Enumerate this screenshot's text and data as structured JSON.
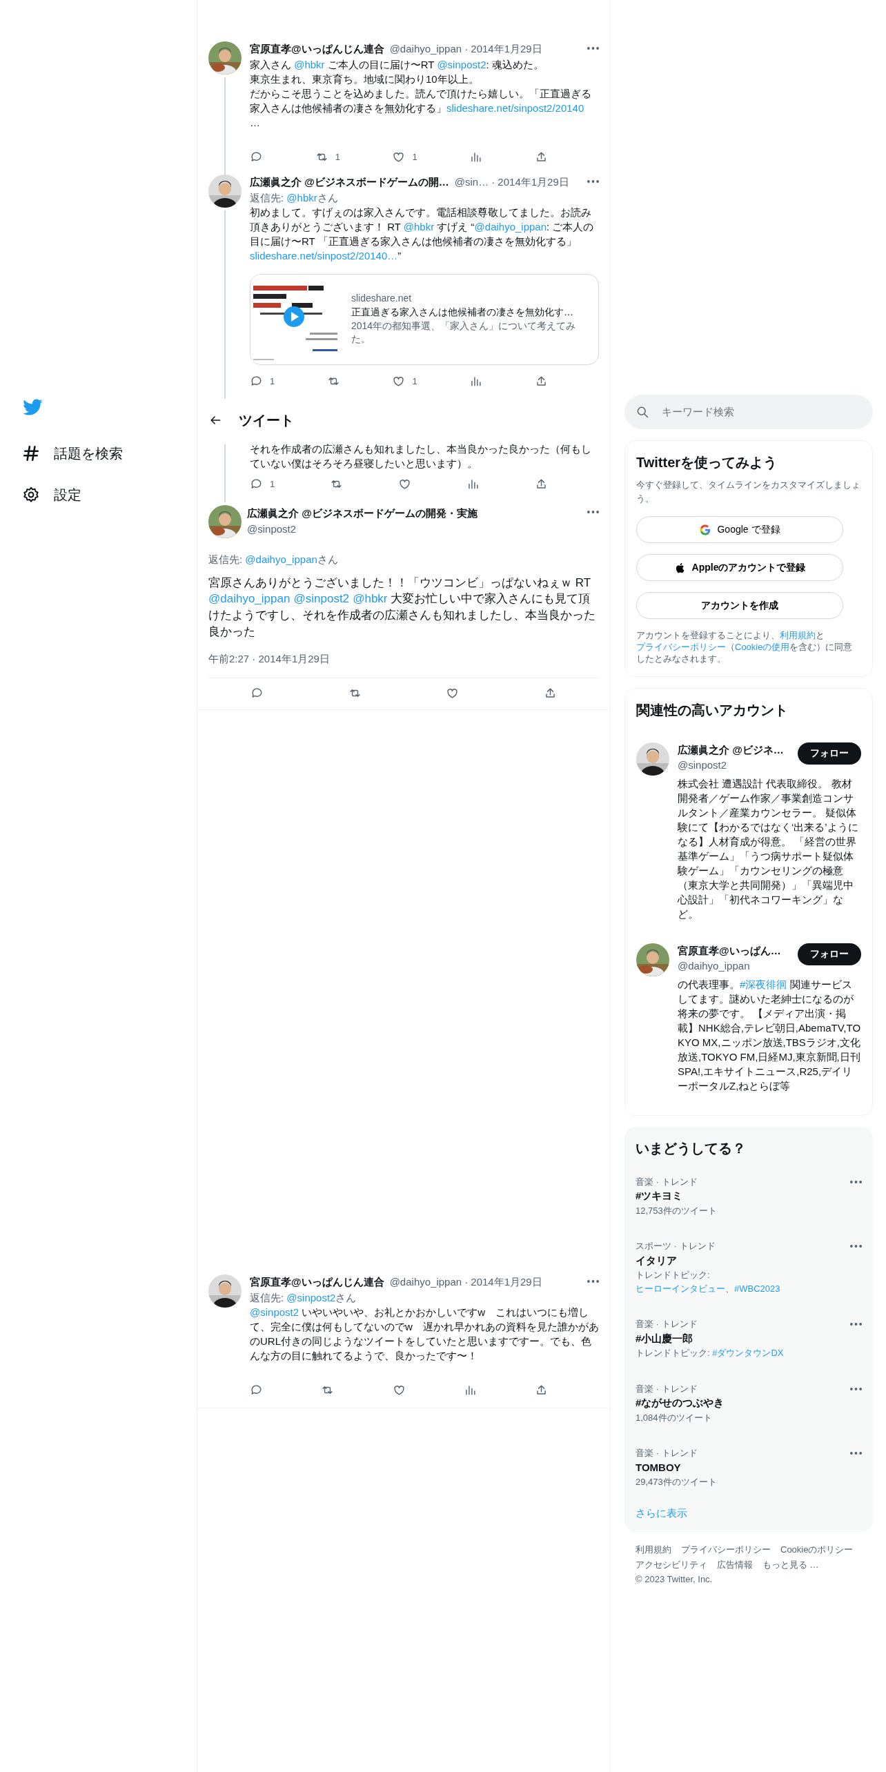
{
  "nav": {
    "items": [
      {
        "kind": "hash",
        "label": "話題を検索"
      },
      {
        "kind": "gear",
        "label": "設定"
      }
    ]
  },
  "timeline": [
    {
      "kind": "tweet",
      "name": "宮原直孝@いっぱんじん連合",
      "handle": "@daihyo_ippan",
      "date": "· 2014年1月29日",
      "connector": true,
      "body": [
        {
          "text": "家入さん "
        },
        {
          "link": "@hbkr"
        },
        {
          "text": " ご本人の目に届け〜RT "
        },
        {
          "link": "@sinpost2"
        },
        {
          "text": ": 魂込めた。"
        },
        {
          "text": "東京生まれ、東京育ち。地域に関わり10年以上。",
          "break_before": true
        },
        {
          "text": "だからこそ思うことを込めました。読んで頂けたら嬉しい。「正直過ぎる家入さんは他候補者の凄さを無効化する」",
          "break_before": true
        },
        {
          "link": "slideshare.net/sinpost2/20140"
        },
        {
          "text": "…",
          "break_before": true
        }
      ],
      "actions": [
        {
          "kind": "reply"
        },
        {
          "kind": "retweet",
          "count": "1"
        },
        {
          "kind": "like",
          "count": "1"
        },
        {
          "kind": "views"
        },
        {
          "kind": "share"
        }
      ]
    },
    {
      "kind": "tweet",
      "name": "広瀬眞之介 @ビジネスボードゲームの開…",
      "handle": "@sin…",
      "date": "· 2014年1月29日",
      "connector": true,
      "reply_to": [
        {
          "text": "返信先: "
        },
        {
          "link": "@hbkr"
        },
        {
          "text": "さん"
        }
      ],
      "body": [
        {
          "text": "初めまして。すげぇのは家入さんです。電話相談尊敬してました。お読み頂きありがとうございます！ RT "
        },
        {
          "link": "@hbkr"
        },
        {
          "text": " すげえ “"
        },
        {
          "link": "@daihyo_ippan"
        },
        {
          "text": ": ご本人の目に届け〜RT 「正直過ぎる家入さんは他候補者の凄さを無効化する」"
        },
        {
          "link": "slideshare.net/sinpost2/20140…"
        },
        {
          "text": "”"
        }
      ],
      "card": {
        "domain": "slideshare.net",
        "title": "正直過ぎる家入さんは他候補者の凄さを無効化す…",
        "description": "2014年の都知事選、「家入さん」について考えてみた。"
      },
      "actions": [
        {
          "kind": "reply",
          "count": "1"
        },
        {
          "kind": "retweet"
        },
        {
          "kind": "like",
          "count": "1"
        },
        {
          "kind": "views"
        },
        {
          "kind": "share"
        }
      ]
    },
    {
      "kind": "header",
      "title": "ツイート"
    },
    {
      "kind": "partial",
      "connector": true,
      "body": [
        {
          "text": "それを作成者の広瀬さんも知れましたし、本当良かった良かった（何もしていない僕はそろそろ昼寝したいと思います）。"
        }
      ],
      "actions": [
        {
          "kind": "reply",
          "count": "1"
        },
        {
          "kind": "retweet"
        },
        {
          "kind": "like"
        },
        {
          "kind": "views"
        },
        {
          "kind": "share"
        }
      ]
    },
    {
      "kind": "focus",
      "name": "広瀬眞之介 @ビジネスボードゲームの開発・実施",
      "handle": "@sinpost2",
      "reply_to": [
        {
          "text": "返信先: "
        },
        {
          "link": "@daihyo_ippan"
        },
        {
          "text": "さん"
        }
      ],
      "body": [
        {
          "text": "宮原さんありがとうございました！！「ウツコンビ」っぱないねぇｗ RT "
        },
        {
          "link": "@daihyo_ippan"
        },
        {
          "link": "@sinpost2"
        },
        {
          "link": "@hbkr"
        },
        {
          "text": " 大変お忙しい中で家入さんにも見て頂けたようですし、それを作成者の広瀬さんも知れましたし、本当良かった良かった"
        }
      ],
      "time": "午前2:27 · 2014年1月29日",
      "actions": [
        {
          "kind": "reply"
        },
        {
          "kind": "retweet"
        },
        {
          "kind": "like"
        },
        {
          "kind": "share"
        }
      ]
    },
    {
      "kind": "tweet",
      "name": "宮原直孝@いっぱんじん連合",
      "handle": "@daihyo_ippan",
      "date": "· 2014年1月29日",
      "connector": false,
      "reply_to": [
        {
          "text": "返信先: "
        },
        {
          "link": "@sinpost2"
        },
        {
          "text": "さん"
        }
      ],
      "body": [
        {
          "link": "@sinpost2"
        },
        {
          "text": " いやいやいや、お礼とかおかしいですw　これはいつにも増して、完全に僕は何もしてないのでw　遅かれ早かれあの資料を見た誰かがあのURL付きの同じようなツイートをしていたと思いますですー。でも、色んな方の目に触れてるようで、良かったです〜！"
        }
      ],
      "actions": [
        {
          "kind": "reply"
        },
        {
          "kind": "retweet"
        },
        {
          "kind": "like"
        },
        {
          "kind": "views"
        },
        {
          "kind": "share"
        }
      ]
    }
  ],
  "search": {
    "placeholder": "キーワード検索"
  },
  "signup": {
    "title": "Twitterを使ってみよう",
    "subtitle": "今すぐ登録して、タイムラインをカスタマイズしましょう。",
    "buttons": [
      {
        "kind": "google",
        "label": "Google で登録"
      },
      {
        "kind": "apple",
        "label": "Appleのアカウントで登録"
      },
      {
        "kind": "plain",
        "label": "アカウントを作成"
      }
    ],
    "legal": [
      {
        "text": "アカウントを登録することにより、"
      },
      {
        "link": "利用規約"
      },
      {
        "text": "と"
      },
      {
        "link": "プライバシーポリシー"
      },
      {
        "text": "（"
      },
      {
        "link": "Cookieの使用"
      },
      {
        "text": "を含む）に同意したとみなされます。"
      }
    ]
  },
  "related": {
    "title": "関連性の高いアカウント",
    "accounts": [
      {
        "name": "広瀬眞之介 @ビジネ…",
        "handle": "@sinpost2",
        "button": "フォロー",
        "bio": [
          {
            "text": "株式会社 遭遇設計 代表取締役。 教材開発者／ゲーム作家／事業創造コンサルタント／産業カウンセラー。 疑似体験にて【わかるではなく‘出来る’ようになる】人材育成が得意。 「経営の世界基準ゲーム」「うつ病サポート疑似体験ゲーム」「カウンセリングの極意（東京大学と共同開発）」「異端児中心設計」「初代ネコワーキング」など。"
          }
        ]
      },
      {
        "name": "宮原直孝@いっぱん…",
        "handle": "@daihyo_ippan",
        "button": "フォロー",
        "bio": [
          {
            "text": "の代表理事。"
          },
          {
            "link": "#深夜徘徊"
          },
          {
            "text": " 関連サービスしてます。謎めいた老紳士になるのが将来の夢です。 【メディア出演・掲載】NHK総合,テレビ朝日,AbemaTV,TOKYO MX,ニッポン放送,TBSラジオ,文化放送,TOKYO FM,日経MJ,東京新聞,日刊SPA!,エキサイトニュース,R25,デイリーポータルZ,ねとらぼ等"
          }
        ]
      }
    ]
  },
  "trends": {
    "title": "いまどうしてる？",
    "items": [
      {
        "meta": "音楽 · トレンド",
        "title": "#ツキヨミ",
        "detail": [
          {
            "text": "12,753件のツイート"
          }
        ]
      },
      {
        "meta": "スポーツ · トレンド",
        "title": "イタリア",
        "detail": [
          {
            "text": "トレンドトピック: "
          },
          {
            "link": "ヒーローインタビュー"
          },
          {
            "text": "、"
          },
          {
            "link": "#WBC2023"
          }
        ]
      },
      {
        "meta": "音楽 · トレンド",
        "title": "#小山慶一郎",
        "detail": [
          {
            "text": "トレンドトピック: "
          },
          {
            "link": "#ダウンタウンDX"
          }
        ]
      },
      {
        "meta": "音楽 · トレンド",
        "title": "#ながせのつぶやき",
        "detail": [
          {
            "text": "1,084件のツイート"
          }
        ]
      },
      {
        "meta": "音楽 · トレンド",
        "title": "TOMBOY",
        "detail": [
          {
            "text": "29,473件のツイート"
          }
        ]
      }
    ],
    "more": "さらに表示"
  },
  "footer": {
    "links": [
      "利用規約",
      "プライバシーポリシー",
      "Cookieのポリシー",
      "アクセシビリティ",
      "広告情報",
      "もっと見る …"
    ],
    "copyright": "© 2023 Twitter, Inc."
  }
}
